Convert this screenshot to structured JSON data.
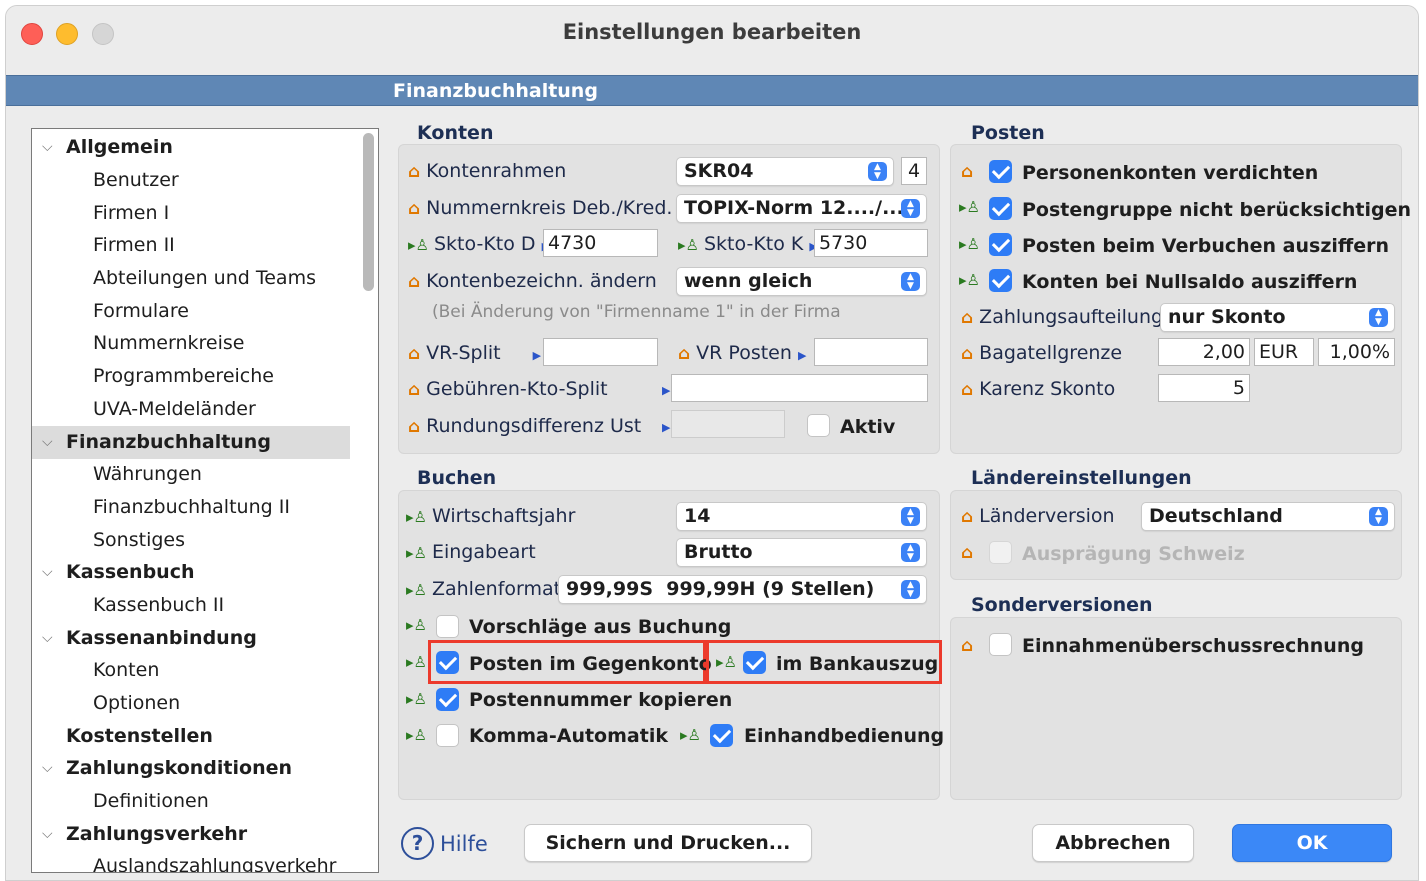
{
  "window": {
    "title": "Einstellungen bearbeiten"
  },
  "section_title": "Finanzbuchhaltung",
  "tree": {
    "items": [
      {
        "label": "Allgemein"
      },
      {
        "label": "Benutzer"
      },
      {
        "label": "Firmen I"
      },
      {
        "label": "Firmen II"
      },
      {
        "label": "Abteilungen und Teams"
      },
      {
        "label": "Formulare"
      },
      {
        "label": "Nummernkreise"
      },
      {
        "label": "Programmbereiche"
      },
      {
        "label": "UVA-Meldeländer"
      },
      {
        "label": "Finanzbuchhaltung"
      },
      {
        "label": "Währungen"
      },
      {
        "label": "Finanzbuchhaltung II"
      },
      {
        "label": "Sonstiges"
      },
      {
        "label": "Kassenbuch"
      },
      {
        "label": "Kassenbuch II"
      },
      {
        "label": "Kassenanbindung"
      },
      {
        "label": "Konten"
      },
      {
        "label": "Optionen"
      },
      {
        "label": "Kostenstellen"
      },
      {
        "label": "Zahlungskonditionen"
      },
      {
        "label": "Definitionen"
      },
      {
        "label": "Zahlungsverkehr"
      },
      {
        "label": "Auslandszahlungsverkehr"
      }
    ]
  },
  "konten": {
    "title": "Konten",
    "kontenrahmen_label": "Kontenrahmen",
    "kontenrahmen_value": "SKR04",
    "kontenrahmen_num": "4",
    "nummernkreis_label": "Nummernkreis Deb./Kred.",
    "nummernkreis_value": "TOPIX-Norm 12..../...",
    "skto_d_label": "Skto-Kto D",
    "skto_d_value": "4730",
    "skto_k_label": "Skto-Kto K",
    "skto_k_value": "5730",
    "kontenbez_label": "Kontenbezeichn. ändern",
    "kontenbez_value": "wenn gleich",
    "kontenbez_note": "(Bei Änderung von \"Firmenname 1\" in der Firma",
    "vr_split_label": "VR-Split",
    "vr_split_value": "",
    "vr_posten_label": "VR Posten",
    "vr_posten_value": "",
    "gebuehren_label": "Gebühren-Kto-Split",
    "gebuehren_value": "",
    "rundung_label": "Rundungsdifferenz Ust",
    "rundung_value": "",
    "aktiv_label": "Aktiv"
  },
  "posten": {
    "title": "Posten",
    "personenkonten_label": "Personenkonten verdichten",
    "postengruppe_label": "Postengruppe nicht berücksichtigen",
    "verbuchen_label": "Posten beim Verbuchen ausziffern",
    "nullsaldo_label": "Konten bei Nullsaldo ausziffern",
    "zahlungsaufteilung_label": "Zahlungsaufteilung",
    "zahlungsaufteilung_value": "nur Skonto",
    "bagatell_label": "Bagatellgrenze",
    "bagatell_value": "2,00",
    "bagatell_currency": "EUR",
    "bagatell_percent": "1,00%",
    "karenz_label": "Karenz Skonto",
    "karenz_value": "5"
  },
  "buchen": {
    "title": "Buchen",
    "wirtschaftsjahr_label": "Wirtschaftsjahr",
    "wirtschaftsjahr_value": "14",
    "eingabeart_label": "Eingabeart",
    "eingabeart_value": "Brutto",
    "zahlenformat_label": "Zahlenformat",
    "zahlenformat_value": "999,99S  999,99H (9 Stellen)",
    "vorschlaege_label": "Vorschläge aus Buchung",
    "gegenkonto_label": "Posten im Gegenkonto",
    "bankauszug_label": "im Bankauszug",
    "postennummer_label": "Postennummer kopieren",
    "komma_label": "Komma-Automatik",
    "einhand_label": "Einhandbedienung"
  },
  "laender": {
    "title": "Ländereinstellungen",
    "version_label": "Länderversion",
    "version_value": "Deutschland",
    "schweiz_label": "Ausprägung Schweiz"
  },
  "sonder": {
    "title": "Sonderversionen",
    "eur_label": "Einnahmenüberschussrechnung"
  },
  "buttons": {
    "help": "Hilfe",
    "save_print": "Sichern und Drucken...",
    "cancel": "Abbrechen",
    "ok": "OK"
  },
  "colors": {
    "accent": "#2e7cf6",
    "section_bar": "#5f87b5",
    "highlight": "#ec3a2c"
  }
}
